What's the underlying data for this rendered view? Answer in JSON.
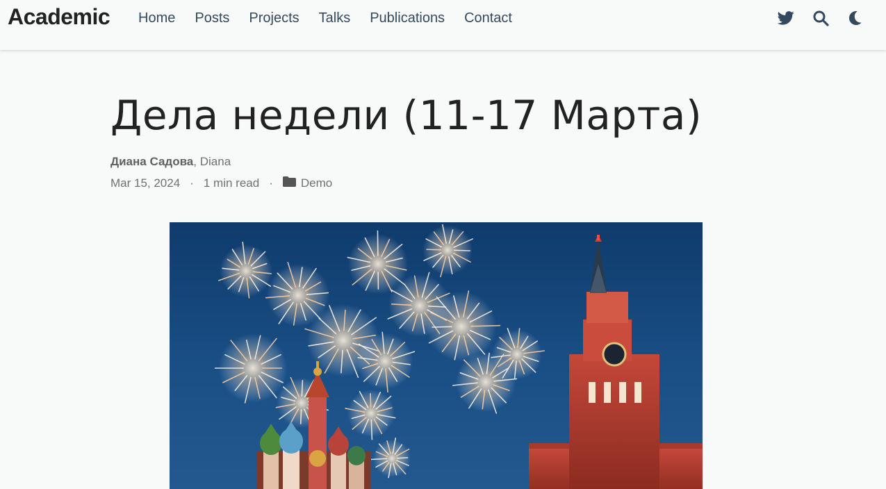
{
  "navbar": {
    "brand": "Academic",
    "links": [
      "Home",
      "Posts",
      "Projects",
      "Talks",
      "Publications",
      "Contact"
    ],
    "icons": [
      "twitter-icon",
      "search-icon",
      "moon-icon"
    ]
  },
  "article": {
    "title": "Дела недели (11-17 Марта)",
    "authors": {
      "primary": "Диана Садова",
      "separator": ",",
      "secondary": "Diana"
    },
    "date": "Mar 15, 2024",
    "dot": "·",
    "reading_time": "1 min read",
    "category": "Demo"
  },
  "hero_image": {
    "subject": "Fireworks over Red Square, Moscow: St. Basil's Cathedral and Spasskaya Tower at night"
  },
  "colors": {
    "background": "#f7faf8",
    "text": "#34495e",
    "sky": "#14457a",
    "tower": "#b03a2e"
  }
}
